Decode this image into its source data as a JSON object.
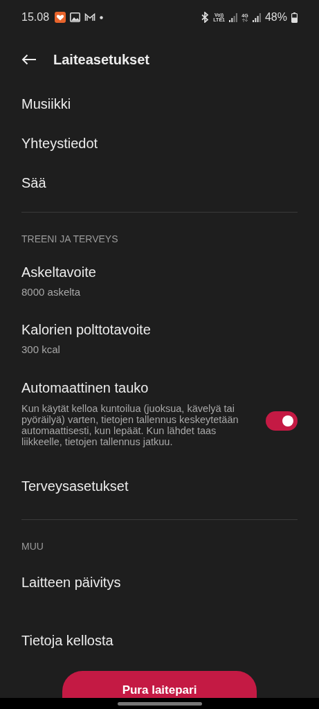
{
  "status_bar": {
    "time": "15.08",
    "volte_top": "Vo))",
    "volte_bottom": "LTE1",
    "network": "4G",
    "battery": "48%"
  },
  "header": {
    "title": "Laiteasetukset"
  },
  "groups": [
    {
      "items": [
        {
          "kind": "plain",
          "title": "Musiikki"
        },
        {
          "kind": "plain",
          "title": "Yhteystiedot"
        },
        {
          "kind": "plain",
          "title": "Sää"
        }
      ]
    },
    {
      "heading": "TREENI JA TERVEYS",
      "items": [
        {
          "kind": "subtitle",
          "title": "Askeltavoite",
          "subtitle": "8000 askelta"
        },
        {
          "kind": "subtitle",
          "title": "Kalorien polttotavoite",
          "subtitle": "300 kcal"
        },
        {
          "kind": "toggle",
          "title": "Automaattinen tauko",
          "description": "Kun käytät kelloa kuntoilua (juoksua, kävelyä tai pyöräilyä) varten, tietojen tallennus keskeytetään automaattisesti, kun lepäät. Kun lähdet taas liikkeelle, tietojen tallennus jatkuu.",
          "on": true
        },
        {
          "kind": "plain",
          "title": "Terveysasetukset"
        }
      ]
    },
    {
      "heading": "MUU",
      "items": [
        {
          "kind": "plain",
          "title": "Laitteen päivitys"
        },
        {
          "kind": "plain",
          "title": "Tietoja kellosta"
        }
      ]
    }
  ],
  "button": "Pura laitepari"
}
